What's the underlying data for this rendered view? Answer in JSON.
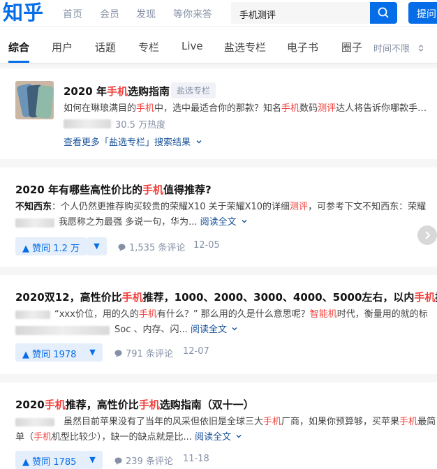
{
  "header": {
    "logo": "知乎",
    "nav": [
      "首页",
      "会员",
      "发现",
      "等你来答"
    ],
    "search_value": "手机测评",
    "ask_label": "提问"
  },
  "tabs": [
    "综合",
    "用户",
    "话题",
    "专栏",
    "Live",
    "盐选专栏",
    "电子书",
    "圈子"
  ],
  "time_filter": "时间不限",
  "special": {
    "title_pre": "2020 年",
    "title_hl": "手机",
    "title_post": "选购指南",
    "badge": "盐选专栏",
    "ex_a": "如何在琳琅满目的",
    "ex_hl1": "手机",
    "ex_b": "中，选中最适合你的那款？知名",
    "ex_hl2": "手机",
    "ex_c": "数码",
    "ex_hl3": "测评",
    "ex_d": "达人将告诉你哪款手…",
    "heat": "30.5 万热度",
    "more": "查看更多「盐选专栏」搜索结果"
  },
  "results": [
    {
      "title_pre": "2020 年有哪些高性价比的",
      "title_hl": "手机",
      "title_post": "值得推荐?",
      "author": "不知西东",
      "line1_a": "：个人仍然更推荐购买较贵的荣耀X10 关于荣耀X10的详细",
      "line1_hl": "测评",
      "line1_b": "，可参考下文不知西东：荣耀",
      "line2": "我愿称之为最强 多说一句，华为...",
      "read": "阅读全文",
      "vote": "赞同 1.2 万",
      "comments": "1,535 条评论",
      "date": "12-05"
    },
    {
      "title_pre": "2020双12，高性价比",
      "title_hl": "手机",
      "title_mid": "推荐，1000、2000、3000、4000、5000左右，以内",
      "title_hl2": "手机",
      "title_post": "推荐",
      "line1_a": "“xxx价位，用的久的",
      "line1_hl": "手机",
      "line1_b": "有什么？” 那么用的久是什么意思呢？",
      "line1_hl2": "智能机",
      "line1_c": "时代，衡量用的就的标",
      "line2": "Soc 、内存、闪...",
      "read": "阅读全文",
      "vote": "赞同 1978",
      "comments": "791 条评论",
      "date": "12-07"
    },
    {
      "title_pre": "2020",
      "title_hl": "手机",
      "title_mid": "推荐，高性价比",
      "title_hl2": "手机",
      "title_post": "选购指南（双十一）",
      "line1_a": "虽然目前苹果没有了当年的风采但依旧是全球三大",
      "line1_hl": "手机",
      "line1_b": "厂商，如果你预算够，买苹果",
      "line1_hl2": "手机",
      "line1_c": "最简",
      "line2_a": "单（",
      "line2_hl": "手机",
      "line2_b": "机型比较少），缺一的缺点就是比...",
      "read": "阅读全文",
      "vote": "赞同 1785",
      "comments": "239 条评论",
      "date": "11-18"
    }
  ]
}
